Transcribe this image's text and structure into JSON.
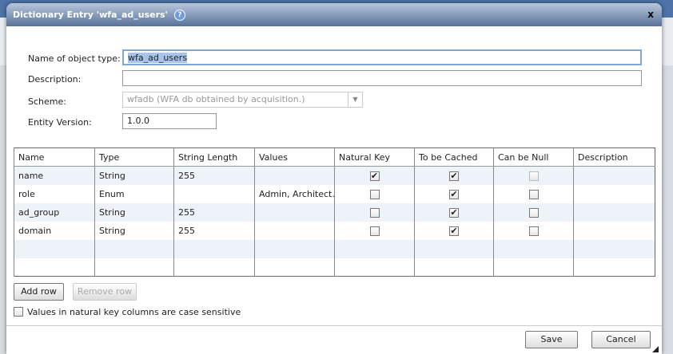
{
  "title": "Dictionary Entry 'wfa_ad_users'",
  "help_icon": "?",
  "close_label": "x",
  "form": {
    "name_label": "Name of object type:",
    "name_value": "wfa_ad_users",
    "description_label": "Description:",
    "description_value": "",
    "scheme_label": "Scheme:",
    "scheme_value": "wfadb (WFA db obtained by acquisition.)",
    "version_label": "Entity Version:",
    "version_value": "1.0.0"
  },
  "table": {
    "columns": [
      "Name",
      "Type",
      "String Length",
      "Values",
      "Natural Key",
      "To be Cached",
      "Can be Null",
      "Description"
    ],
    "rows": [
      {
        "name": "name",
        "type": "String",
        "length": "255",
        "values": "",
        "natural_key": true,
        "cached": true,
        "nullable": false,
        "nullable_disabled": true,
        "description": ""
      },
      {
        "name": "role",
        "type": "Enum",
        "length": "",
        "values": "Admin, Architect...",
        "natural_key": false,
        "cached": true,
        "nullable": false,
        "description": ""
      },
      {
        "name": "ad_group",
        "type": "String",
        "length": "255",
        "values": "",
        "natural_key": false,
        "cached": true,
        "nullable": false,
        "description": ""
      },
      {
        "name": "domain",
        "type": "String",
        "length": "255",
        "values": "",
        "natural_key": false,
        "cached": true,
        "nullable": false,
        "description": ""
      }
    ],
    "empty_rows": 2
  },
  "buttons": {
    "add_row": "Add row",
    "remove_row": "Remove row",
    "save": "Save",
    "cancel": "Cancel"
  },
  "case_sensitive": {
    "label": "Values in natural key columns are case sensitive",
    "checked": false
  }
}
